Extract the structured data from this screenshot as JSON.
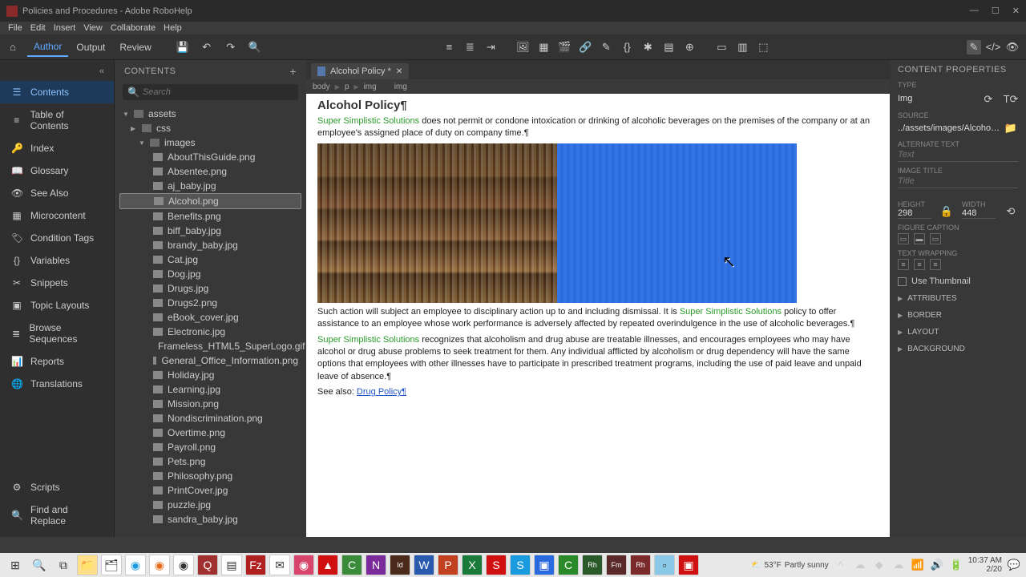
{
  "titlebar": {
    "title": "Policies and Procedures - Adobe RoboHelp"
  },
  "menus": [
    "File",
    "Edit",
    "Insert",
    "View",
    "Collaborate",
    "Help"
  ],
  "top_tabs": {
    "author": "Author",
    "output": "Output",
    "review": "Review"
  },
  "nav": {
    "items": [
      {
        "icon": "☰",
        "label": "Contents",
        "active": true
      },
      {
        "icon": "≡",
        "label": "Table of Contents"
      },
      {
        "icon": "🔑",
        "label": "Index"
      },
      {
        "icon": "📖",
        "label": "Glossary"
      },
      {
        "icon": "👁",
        "label": "See Also"
      },
      {
        "icon": "▦",
        "label": "Microcontent"
      },
      {
        "icon": "🏷",
        "label": "Condition Tags"
      },
      {
        "icon": "{}",
        "label": "Variables"
      },
      {
        "icon": "✂",
        "label": "Snippets"
      },
      {
        "icon": "▣",
        "label": "Topic Layouts"
      },
      {
        "icon": "≣",
        "label": "Browse Sequences"
      },
      {
        "icon": "📊",
        "label": "Reports"
      },
      {
        "icon": "🌐",
        "label": "Translations"
      }
    ],
    "bottom": [
      {
        "icon": "⚙",
        "label": "Scripts"
      },
      {
        "icon": "🔍",
        "label": "Find and Replace"
      }
    ]
  },
  "contents": {
    "title": "CONTENTS",
    "search_placeholder": "Search",
    "folders": {
      "assets": "assets",
      "css": "css",
      "images": "images"
    },
    "files": [
      "AboutThisGuide.png",
      "Absentee.png",
      "aj_baby.jpg",
      "Alcohol.png",
      "Benefits.png",
      "biff_baby.jpg",
      "brandy_baby.jpg",
      "Cat.jpg",
      "Dog.jpg",
      "Drugs.jpg",
      "Drugs2.png",
      "eBook_cover.jpg",
      "Electronic.jpg",
      "Frameless_HTML5_SuperLogo.gif",
      "General_Office_Information.png",
      "Holiday.jpg",
      "Learning.jpg",
      "Mission.png",
      "Nondiscrimination.png",
      "Overtime.png",
      "Payroll.png",
      "Pets.png",
      "Philosophy.png",
      "PrintCover.jpg",
      "puzzle.jpg",
      "sandra_baby.jpg"
    ],
    "selected": "Alcohol.png"
  },
  "editor": {
    "tab_label": "Alcohol Policy *",
    "breadcrumb": [
      "body",
      "p",
      "img",
      "img"
    ],
    "title": "Alcohol Policy¶",
    "brand": "Super Simplistic Solutions",
    "p1a": " does not permit or condone intoxication or drinking of alcoholic beverages on the premises of the company or at an employee's assigned place of duty on company time.¶",
    "p2a": "Such action will subject an employee to disciplinary action up to and including dismissal. It is ",
    "p2b": " policy to offer assistance to an employee whose work performance is adversely affected by repeated overindulgence in the use of alcoholic beverages.¶",
    "p3": " recognizes that alcoholism and drug abuse are treatable illnesses, and encourages employees who may have alcohol or drug abuse problems to seek treatment for them. Any individual afflicted by alcoholism or drug dependency will have the same options that employees with other illnesses have to participate in prescribed treatment programs, including the use of paid leave and unpaid leave of absence.¶",
    "seealso_label": "See also: ",
    "seealso_link": "Drug Policy¶"
  },
  "props": {
    "title": "CONTENT PROPERTIES",
    "type_label": "TYPE",
    "type_value": "Img",
    "source_label": "Source",
    "source_value": "../assets/images/Alcohol.png",
    "alt_label": "Alternate Text",
    "alt_placeholder": "Text",
    "imgtitle_label": "Image Title",
    "imgtitle_placeholder": "Title",
    "height_label": "Height",
    "height_value": "298",
    "width_label": "Width",
    "width_value": "448",
    "figcap_label": "Figure Caption",
    "textwrap_label": "Text wrapping",
    "thumb_label": "Use Thumbnail",
    "sections": [
      "ATTRIBUTES",
      "BORDER",
      "LAYOUT",
      "BACKGROUND"
    ]
  },
  "taskbar": {
    "temp": "53°F",
    "weather": "Partly sunny",
    "time": "10:37 AM",
    "date": "2/20"
  }
}
